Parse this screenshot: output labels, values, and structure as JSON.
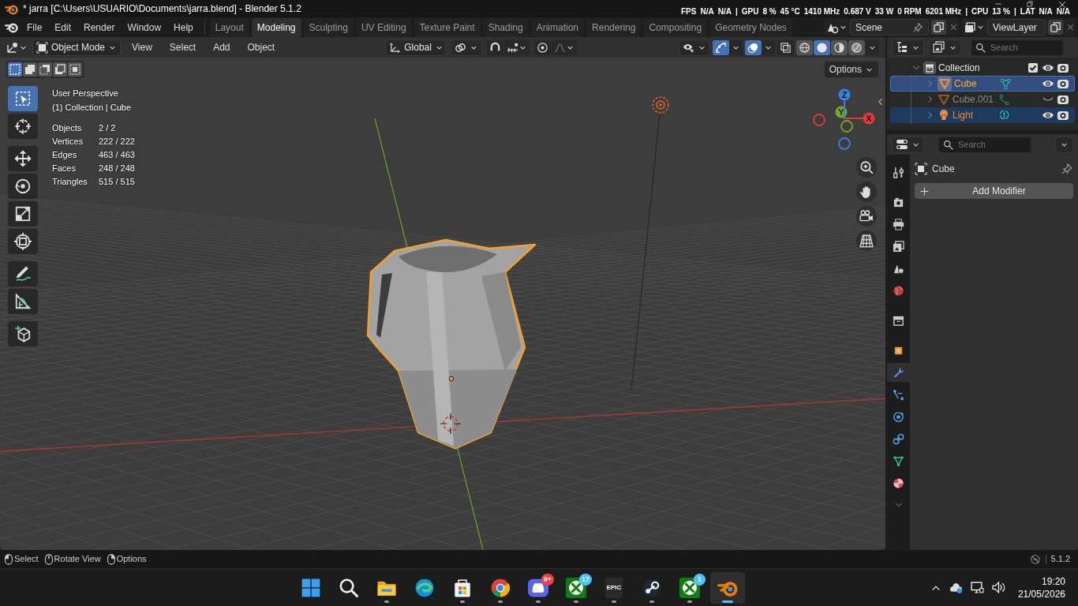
{
  "title_bar": {
    "title": "* jarra [C:\\Users\\USUARIO\\Documents\\jarra.blend] - Blender 5.1.2",
    "monitor": [
      "FPS",
      "N/A",
      "N/A",
      "|",
      "GPU",
      "8 %",
      "45 °C",
      "1410 MHz",
      "0.687 V",
      "33 W",
      "0 RPM",
      "6201 MHz",
      "|",
      "CPU",
      "13 %",
      "|",
      "LAT",
      "N/A",
      "N/A"
    ]
  },
  "menu": [
    "File",
    "Edit",
    "Render",
    "Window",
    "Help"
  ],
  "workspaces": [
    {
      "label": "Layout",
      "selected": false
    },
    {
      "label": "Modeling",
      "selected": true
    },
    {
      "label": "Sculpting",
      "selected": false
    },
    {
      "label": "UV Editing",
      "selected": false
    },
    {
      "label": "Texture Paint",
      "selected": false
    },
    {
      "label": "Shading",
      "selected": false
    },
    {
      "label": "Animation",
      "selected": false
    },
    {
      "label": "Rendering",
      "selected": false
    },
    {
      "label": "Compositing",
      "selected": false
    },
    {
      "label": "Geometry Nodes",
      "selected": false
    }
  ],
  "scene": {
    "name": "Scene"
  },
  "view_layer": {
    "name": "ViewLayer"
  },
  "viewport": {
    "mode": "Object Mode",
    "menus": [
      "View",
      "Select",
      "Add",
      "Object"
    ],
    "orientation": "Global",
    "left_toggles": [
      {
        "kind": "snap",
        "on": false
      },
      {
        "kind": "proportional",
        "on": false
      }
    ],
    "right_toggles": [
      {
        "kind": "gizmo",
        "on": true
      },
      {
        "kind": "overlay",
        "on": true
      },
      {
        "kind": "xray",
        "on": false
      }
    ],
    "shading": [
      {
        "kind": "wireframe",
        "selected": false
      },
      {
        "kind": "solid",
        "selected": true
      },
      {
        "kind": "material",
        "selected": false
      },
      {
        "kind": "rendered",
        "selected": false
      }
    ],
    "select_modes": [
      {
        "kind": "set",
        "selected": true
      },
      {
        "kind": "extend",
        "selected": false
      },
      {
        "kind": "subtract",
        "selected": false
      },
      {
        "kind": "difference",
        "selected": false
      },
      {
        "kind": "intersect",
        "selected": false
      }
    ],
    "options": "Options",
    "view_name": "User Perspective",
    "context": "(1) Collection | Cube",
    "stats": [
      {
        "label": "Objects",
        "value": "2 / 2"
      },
      {
        "label": "Vertices",
        "value": "222 / 222"
      },
      {
        "label": "Edges",
        "value": "463 / 463"
      },
      {
        "label": "Faces",
        "value": "248 / 248"
      },
      {
        "label": "Triangles",
        "value": "515 / 515"
      }
    ],
    "tools": [
      {
        "kind": "select",
        "selected": true
      },
      {
        "kind": "cursor",
        "selected": false
      },
      {
        "kind": "move",
        "selected": false
      },
      {
        "kind": "rotate",
        "selected": false
      },
      {
        "kind": "scale",
        "selected": false
      },
      {
        "kind": "transform",
        "selected": false
      },
      {
        "kind": "annotate",
        "selected": false
      },
      {
        "kind": "measure",
        "selected": false
      },
      {
        "kind": "add_cube",
        "selected": false
      }
    ],
    "axes": [
      {
        "label": "X",
        "color": "#e2383f"
      },
      {
        "label": "Y",
        "color": "#74a825"
      },
      {
        "label": "Z",
        "color": "#3a82e0"
      }
    ]
  },
  "outliner": {
    "search_placeholder": "Search",
    "tree": [
      {
        "name": "Collection",
        "checked": true,
        "visible": true,
        "children": [
          {
            "name": "Cube",
            "kind": "mesh",
            "selected": true,
            "active": true,
            "visible": true
          },
          {
            "name": "Cube.001",
            "kind": "edges",
            "selected": false,
            "active": false,
            "visible": false
          },
          {
            "name": "Light",
            "kind": "light",
            "selected": true,
            "active": false,
            "visible": true
          }
        ]
      }
    ]
  },
  "properties": {
    "search_placeholder": "Search",
    "tabs": [
      {
        "kind": "tool",
        "selected": false
      },
      {
        "kind": "render",
        "selected": false
      },
      {
        "kind": "output",
        "selected": false
      },
      {
        "kind": "view_layer",
        "selected": false
      },
      {
        "kind": "scene",
        "selected": false
      },
      {
        "kind": "world",
        "selected": false
      },
      {
        "kind": "collection",
        "selected": false
      },
      {
        "kind": "object",
        "selected": false
      },
      {
        "kind": "modifiers",
        "selected": true
      },
      {
        "kind": "particles",
        "selected": false
      },
      {
        "kind": "physics",
        "selected": false
      },
      {
        "kind": "constraints",
        "selected": false
      },
      {
        "kind": "data",
        "selected": false
      },
      {
        "kind": "material",
        "selected": false
      }
    ],
    "object": "Cube",
    "add_modifier": "Add Modifier"
  },
  "status_bar": {
    "hints": [
      "Select",
      "Rotate View",
      "Options"
    ],
    "version": "5.1.2"
  },
  "taskbar": {
    "apps": [
      {
        "kind": "start",
        "running": false,
        "active": false
      },
      {
        "kind": "search",
        "running": false,
        "active": false
      },
      {
        "kind": "explorer",
        "running": true,
        "active": false
      },
      {
        "kind": "edge",
        "running": false,
        "active": false
      },
      {
        "kind": "store",
        "running": true,
        "active": false
      },
      {
        "kind": "chrome",
        "running": true,
        "active": false
      },
      {
        "kind": "discord",
        "running": true,
        "active": false,
        "badge": "9+",
        "color": "#f23f43"
      },
      {
        "kind": "xbox",
        "running": true,
        "active": false,
        "badge": "17",
        "color": "#4cc2ff"
      },
      {
        "kind": "epic",
        "running": true,
        "active": false,
        "logo": "EPIC"
      },
      {
        "kind": "steam",
        "running": true,
        "active": false
      },
      {
        "kind": "xbox",
        "running": true,
        "active": false,
        "badge": "1",
        "color": "#4cc2ff"
      },
      {
        "kind": "blender",
        "running": true,
        "active": true
      }
    ],
    "time": "19:20",
    "date": "21/05/2026"
  }
}
